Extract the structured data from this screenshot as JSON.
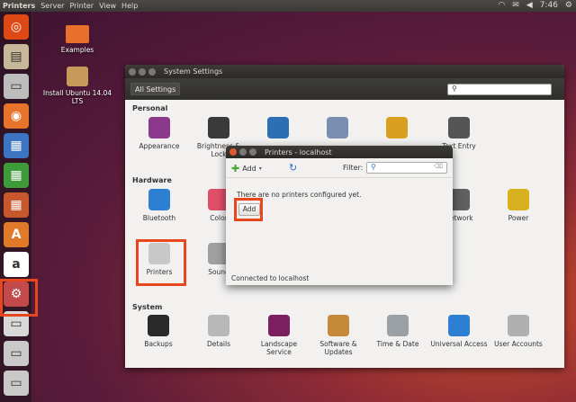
{
  "top_panel": {
    "app_name": "Printers",
    "menus": [
      "Server",
      "Printer",
      "View",
      "Help"
    ],
    "time": "7:46"
  },
  "desktop": {
    "icons": [
      {
        "label": "Examples"
      },
      {
        "label": "Install Ubuntu 14.04 LTS"
      }
    ]
  },
  "launcher": {
    "items": [
      {
        "name": "ubuntu-dash",
        "glyph": "◎",
        "color": "#dd4814"
      },
      {
        "name": "files",
        "glyph": "▤",
        "color": "#c8b89a"
      },
      {
        "name": "disk",
        "glyph": "▭",
        "color": "#bdbdbd"
      },
      {
        "name": "firefox",
        "glyph": "◉",
        "color": "#e7742a"
      },
      {
        "name": "writer",
        "glyph": "▦",
        "color": "#3b74c2"
      },
      {
        "name": "calc",
        "glyph": "▦",
        "color": "#3f9a3a"
      },
      {
        "name": "impress",
        "glyph": "▦",
        "color": "#c7572d"
      },
      {
        "name": "software-center",
        "glyph": "A",
        "color": "#e07a2a"
      },
      {
        "name": "amazon",
        "glyph": "a",
        "color": "#ffffff"
      },
      {
        "name": "system-settings",
        "glyph": "⚙",
        "color": "#c24a4a"
      },
      {
        "name": "printer",
        "glyph": "▭",
        "color": "#d9d9d9"
      },
      {
        "name": "drive-1",
        "glyph": "▭",
        "color": "#c9c9c9"
      },
      {
        "name": "drive-2",
        "glyph": "▭",
        "color": "#c9c9c9"
      }
    ]
  },
  "settings_window": {
    "title": "System Settings",
    "all_settings": "All Settings",
    "sections": {
      "personal": "Personal",
      "hardware": "Hardware",
      "system": "System"
    },
    "personal_items": [
      {
        "label": "Appearance",
        "color": "#8b3a8b"
      },
      {
        "label": "Brightness & Lock",
        "color": "#3a3a3a"
      },
      {
        "label": "",
        "color": "#2d6fb3"
      },
      {
        "label": "",
        "color": "#7a8fb0"
      },
      {
        "label": "",
        "color": "#d9a020"
      },
      {
        "label": "Text Entry",
        "color": "#555555"
      }
    ],
    "hardware_items": [
      {
        "label": "Bluetooth",
        "color": "#2d7fd1"
      },
      {
        "label": "Color",
        "color": "#e04e6a"
      },
      {
        "label": "Printers",
        "color": "#c8c8c8"
      },
      {
        "label": "Sound",
        "color": "#a0a0a0"
      },
      {
        "label": "Network",
        "color": "#606060"
      },
      {
        "label": "Power",
        "color": "#d8b020"
      }
    ],
    "system_items": [
      {
        "label": "Backups",
        "color": "#2a2a2a"
      },
      {
        "label": "Details",
        "color": "#b8b8b8"
      },
      {
        "label": "Landscape Service",
        "color": "#7b1f5e"
      },
      {
        "label": "Software & Updates",
        "color": "#c48a3a"
      },
      {
        "label": "Time & Date",
        "color": "#9aa0a6"
      },
      {
        "label": "Universal Access",
        "color": "#2d7fd1"
      },
      {
        "label": "User Accounts",
        "color": "#b0b0b0"
      }
    ]
  },
  "printers_window": {
    "title": "Printers - localhost",
    "add_toolbar_label": "Add",
    "filter_label": "Filter:",
    "empty_message": "There are no printers configured yet.",
    "add_button_label": "Add",
    "status": "Connected to localhost"
  },
  "colors": {
    "highlight": "#e8461c",
    "panel": "#3c3b37"
  }
}
